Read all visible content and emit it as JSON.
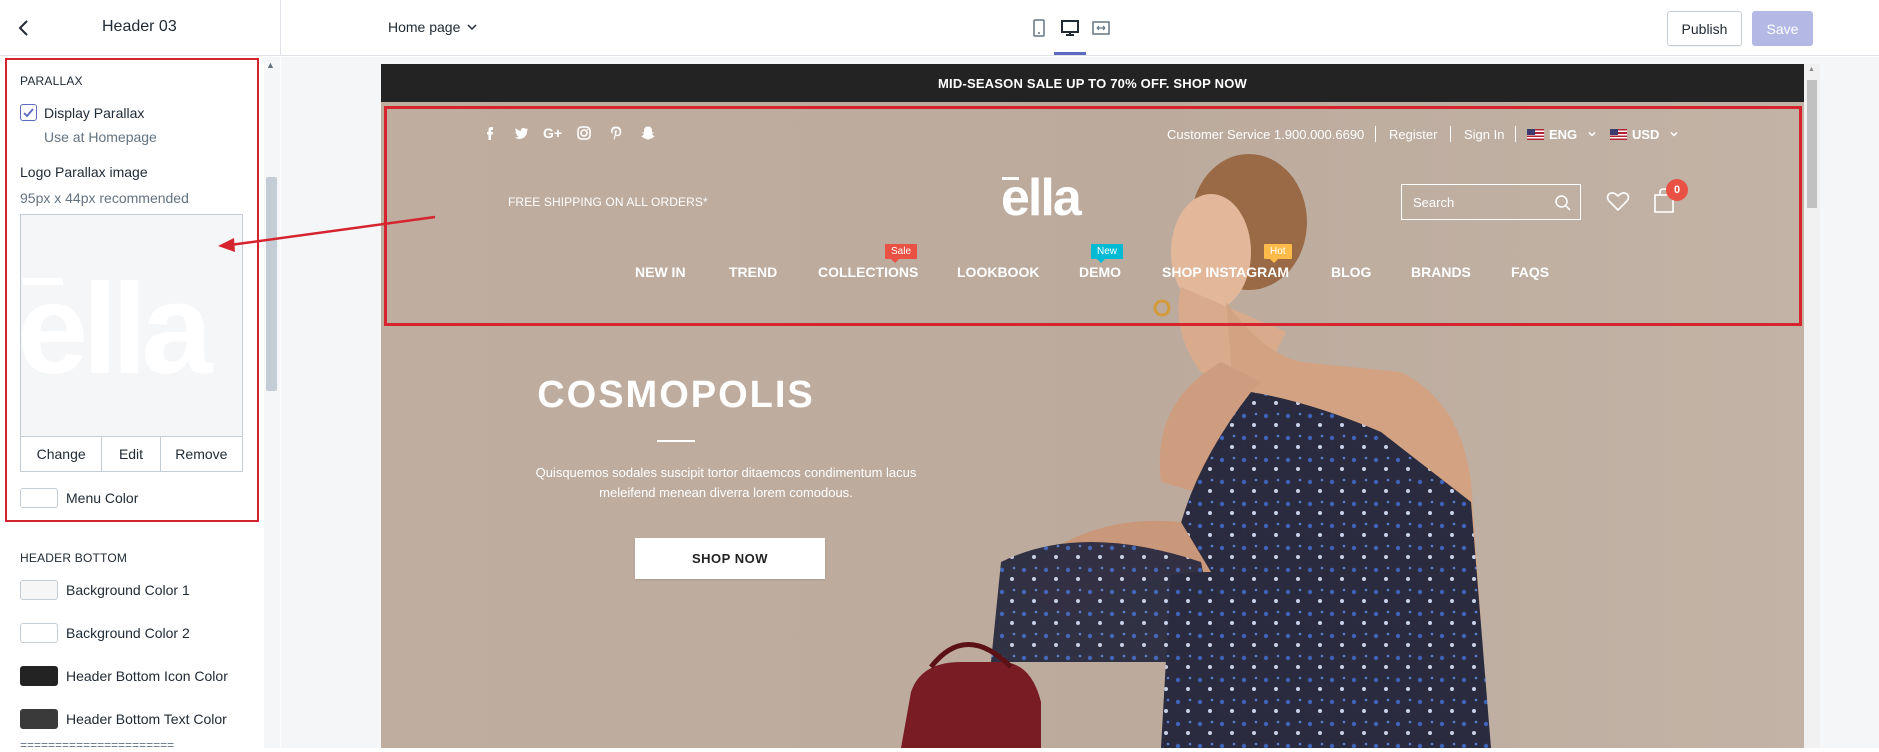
{
  "topbar": {
    "title": "Header 03",
    "page_select": "Home page",
    "publish_label": "Publish",
    "save_label": "Save"
  },
  "sidebar": {
    "parallax": {
      "heading": "PARALLAX",
      "display_parallax_label": "Display Parallax",
      "display_parallax_checked": true,
      "display_parallax_help": "Use at Homepage",
      "logo_label": "Logo Parallax image",
      "logo_help": "95px x 44px recommended",
      "logo_preview_text": "ella",
      "change_label": "Change",
      "edit_label": "Edit",
      "remove_label": "Remove",
      "menu_color_label": "Menu Color",
      "menu_color": "#ffffff"
    },
    "header_bottom": {
      "heading": "HEADER BOTTOM",
      "colors": [
        {
          "label": "Background Color 1",
          "color": "#f6f6f6"
        },
        {
          "label": "Background Color 2",
          "color": "#ffffff"
        },
        {
          "label": "Header Bottom Icon Color",
          "color": "#232323"
        },
        {
          "label": "Header Bottom Text Color",
          "color": "#3a3a3a"
        }
      ],
      "divider": "======================"
    }
  },
  "preview": {
    "announcement": "MID-SEASON SALE UP TO 70% OFF. SHOP NOW",
    "social_icons": [
      "facebook-icon",
      "twitter-icon",
      "google-plus-icon",
      "instagram-icon",
      "pinterest-icon",
      "snapchat-icon"
    ],
    "customer_service": "Customer Service 1.900.000.6690",
    "register": "Register",
    "sign_in": "Sign In",
    "language": "ENG",
    "currency": "USD",
    "free_shipping": "FREE SHIPPING ON ALL ORDERS*",
    "logo": "ella",
    "search_placeholder": "Search",
    "cart_count": "0",
    "nav": [
      {
        "label": "NEW IN"
      },
      {
        "label": "TREND"
      },
      {
        "label": "COLLECTIONS",
        "badge": "Sale",
        "badge_color": "#e95144"
      },
      {
        "label": "LOOKBOOK"
      },
      {
        "label": "DEMO",
        "badge": "New",
        "badge_color": "#01bad4"
      },
      {
        "label": "SHOP INSTAGRAM",
        "badge": "Hot",
        "badge_color": "#ffbb49"
      },
      {
        "label": "BLOG"
      },
      {
        "label": "BRANDS"
      },
      {
        "label": "FAQS"
      }
    ],
    "hero": {
      "title": "COSMOPOLIS",
      "copy_line1": "Quisquemos sodales suscipit tortor ditaemcos condimentum lacus",
      "copy_line2": "meleifend menean diverra lorem comodous.",
      "button": "SHOP NOW"
    }
  },
  "colors": {
    "accent": "#5c6ac4",
    "annotation_red": "#d6242e",
    "hero_bg": "#bcab9d"
  }
}
